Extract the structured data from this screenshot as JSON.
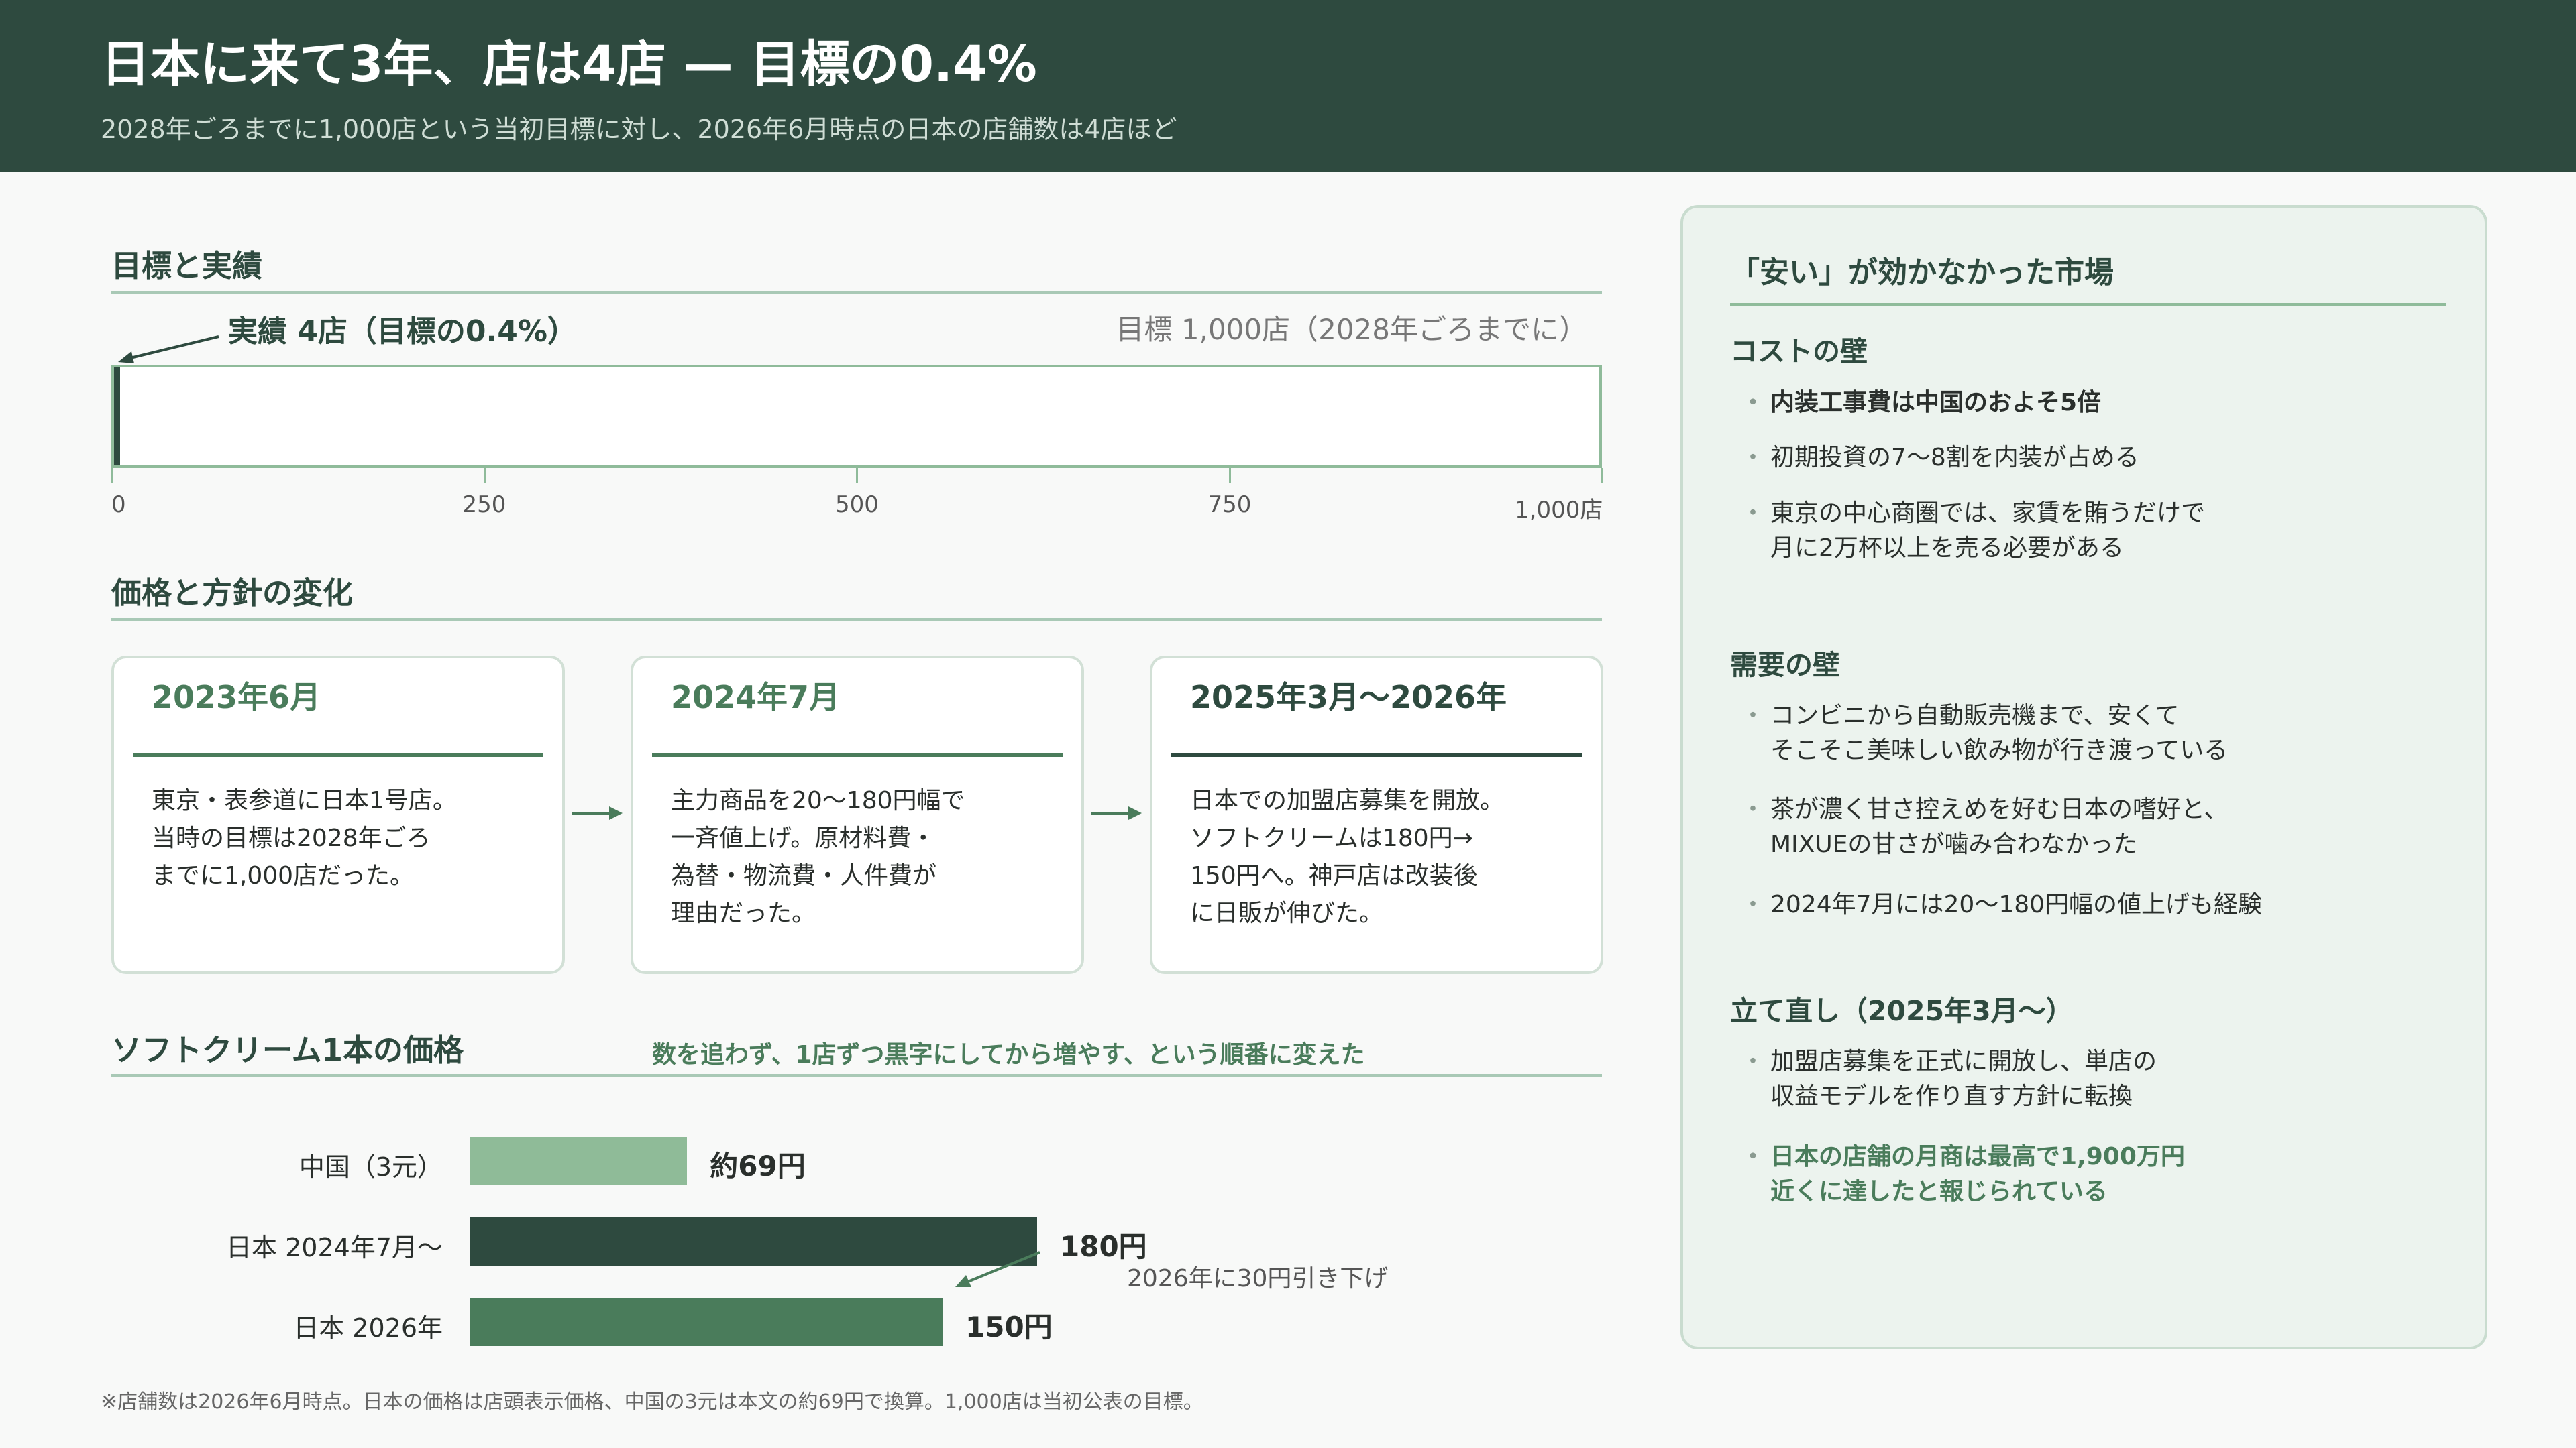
{
  "header": {
    "title": "日本に来て3年、店は4店 — 目標の0.4%",
    "subtitle": "2028年ごろまでに1,000店という当初目標に対し、2026年6月時点の日本の店舗数は4店ほど"
  },
  "goal_section": {
    "title": "目標と実績",
    "actual_label": "実績 4店（目標の0.4%）",
    "target_label": "目標 1,000店（2028年ごろまでに）",
    "ticks": [
      "0",
      "250",
      "500",
      "750",
      "1,000店"
    ],
    "actual": 4,
    "target": 1000
  },
  "timeline": {
    "title": "価格と方針の変化",
    "cards": [
      {
        "date": "2023年6月",
        "body": "東京・表参道に日本1号店。\n当時の目標は2028年ごろ\nまでに1,000店だった。"
      },
      {
        "date": "2024年7月",
        "body": "主力商品を20〜180円幅で\n一斉値上げ。原材料費・\n為替・物流費・人件費が\n理由だった。"
      },
      {
        "date": "2025年3月〜2026年",
        "body": "日本での加盟店募集を開放。\nソフトクリームは180円→\n150円へ。神戸店は改装後\nに日販が伸びた。"
      }
    ]
  },
  "price_section": {
    "title": "ソフトクリーム1本の価格",
    "note": "数を追わず、1店ずつ黒字にしてから増やす、という順番に変えた",
    "annotation": "2026年に30円引き下げ"
  },
  "chart_data": {
    "type": "bar",
    "orientation": "horizontal",
    "categories": [
      "中国（3元）",
      "日本 2024年7月〜",
      "日本 2026年"
    ],
    "values": [
      69,
      180,
      150
    ],
    "value_labels": [
      "約69円",
      "180円",
      "150円"
    ],
    "colors": [
      "#8fbb98",
      "#2e4a3f",
      "#4a7c5b"
    ],
    "title": "ソフトクリーム1本の価格",
    "unit": "円"
  },
  "panel": {
    "title": "「安い」が効かなかった市場",
    "groups": [
      {
        "title": "コストの壁",
        "items": [
          {
            "text": "内装工事費は中国のおよそ5倍",
            "style": "strong"
          },
          {
            "text": "初期投資の7〜8割を内装が占める",
            "style": "normal"
          },
          {
            "text": "東京の中心商圏では、家賃を賄うだけで\n月に2万杯以上を売る必要がある",
            "style": "normal"
          }
        ]
      },
      {
        "title": "需要の壁",
        "items": [
          {
            "text": "コンビニから自動販売機まで、安くて\nそこそこ美味しい飲み物が行き渡っている",
            "style": "normal"
          },
          {
            "text": "茶が濃く甘さ控えめを好む日本の嗜好と、\nMIXUEの甘さが噛み合わなかった",
            "style": "normal"
          },
          {
            "text": "2024年7月には20〜180円幅の値上げも経験",
            "style": "normal"
          }
        ]
      },
      {
        "title": "立て直し（2025年3月〜）",
        "items": [
          {
            "text": "加盟店募集を正式に開放し、単店の\n収益モデルを作り直す方針に転換",
            "style": "normal"
          },
          {
            "text": "日本の店舗の月商は最高で1,900万円\n近くに達したと報じられている",
            "style": "accent"
          }
        ]
      }
    ]
  },
  "footnote": "※店舗数は2026年6月時点。日本の価格は店頭表示価格、中国の3元は本文の約69円で換算。1,000店は当初公表の目標。"
}
